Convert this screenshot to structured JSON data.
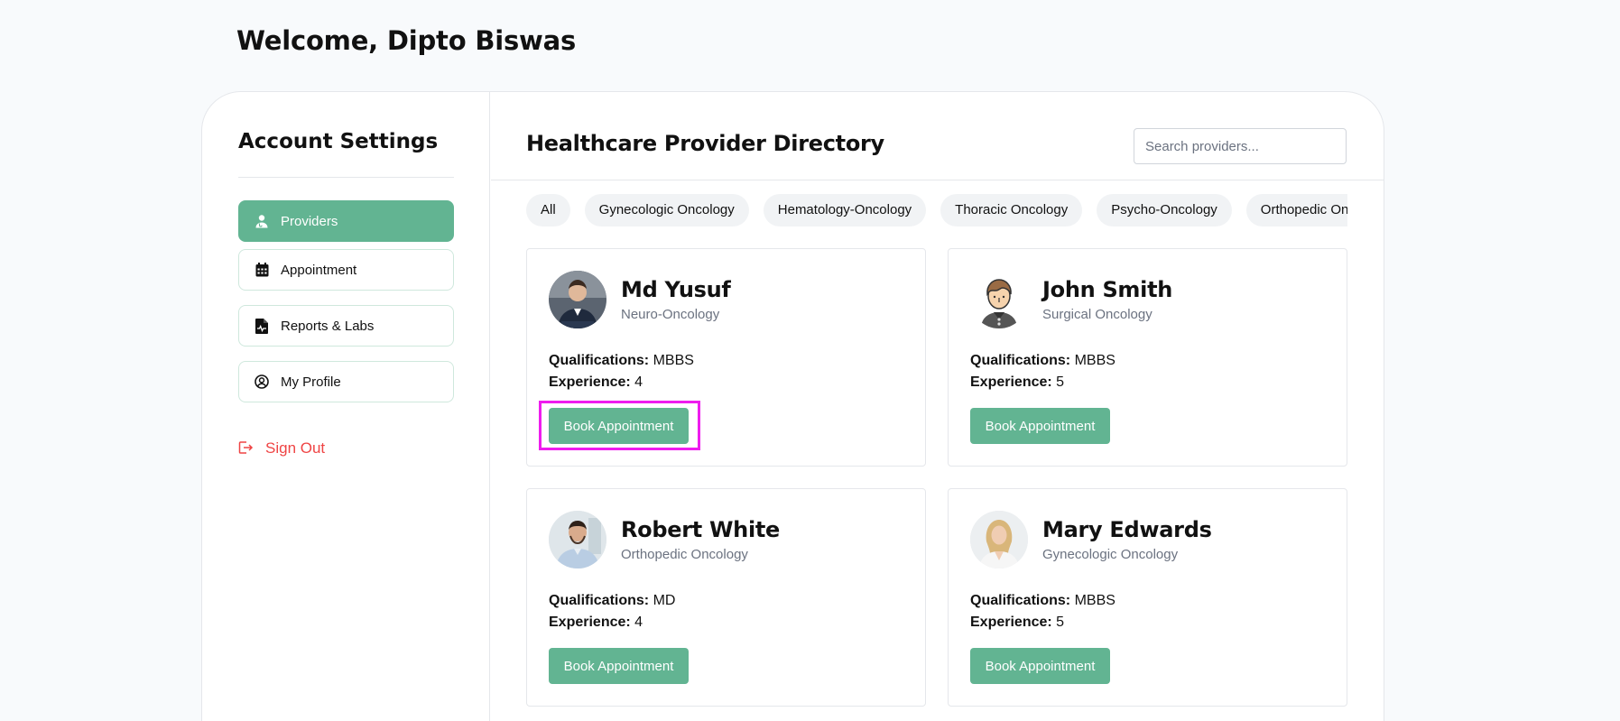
{
  "header": {
    "welcome": "Welcome, Dipto Biswas"
  },
  "sidebar": {
    "title": "Account Settings",
    "items": [
      {
        "label": "Providers",
        "icon": "doctor-icon",
        "active": true
      },
      {
        "label": "Appointment",
        "icon": "calendar-icon",
        "active": false
      },
      {
        "label": "Reports & Labs",
        "icon": "file-medical-icon",
        "active": false
      },
      {
        "label": "My Profile",
        "icon": "user-circle-icon",
        "active": false
      }
    ],
    "signout": "Sign Out"
  },
  "main": {
    "title": "Healthcare Provider Directory",
    "search_placeholder": "Search providers...",
    "filters": [
      "All",
      "Gynecologic Oncology",
      "Hematology-Oncology",
      "Thoracic Oncology",
      "Psycho-Oncology",
      "Orthopedic Oncology"
    ],
    "qual_label": "Qualifications:",
    "exp_label": "Experience:",
    "providers": [
      {
        "name": "Md Yusuf",
        "specialty": "Neuro-Oncology",
        "qualifications": "MBBS",
        "experience": "4",
        "button": "Book Appointment"
      },
      {
        "name": "John Smith",
        "specialty": "Surgical Oncology",
        "qualifications": "MBBS",
        "experience": "5",
        "button": "Book Appointment"
      },
      {
        "name": "Robert White",
        "specialty": "Orthopedic Oncology",
        "qualifications": "MD",
        "experience": "4",
        "button": "Book Appointment"
      },
      {
        "name": "Mary Edwards",
        "specialty": "Gynecologic Oncology",
        "qualifications": "MBBS",
        "experience": "5",
        "button": "Book Appointment"
      }
    ]
  },
  "colors": {
    "accent": "#62b492",
    "signout": "#ef4444",
    "highlight": "#ee1dee"
  }
}
